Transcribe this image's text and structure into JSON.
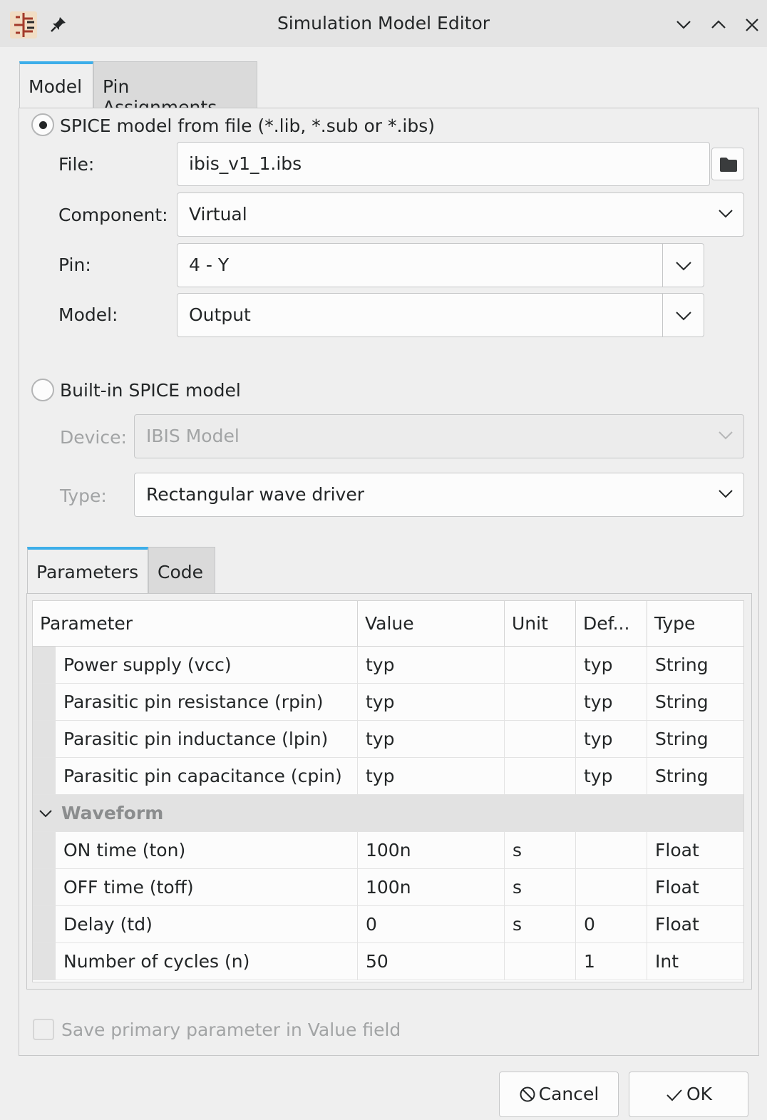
{
  "window": {
    "title": "Simulation Model Editor"
  },
  "top_tabs": [
    {
      "label": "Model",
      "active": true
    },
    {
      "label": "Pin Assignments",
      "active": false
    }
  ],
  "spice_file": {
    "radio_label": "SPICE model from file (*.lib, *.sub or *.ibs)",
    "selected": true,
    "file_label": "File:",
    "file_value": "ibis_v1_1.ibs",
    "component_label": "Component:",
    "component_value": "Virtual",
    "pin_label": "Pin:",
    "pin_value": "4 - Y",
    "model_label": "Model:",
    "model_value": "Output"
  },
  "builtin": {
    "radio_label": "Built-in SPICE model",
    "selected": false,
    "device_label": "Device:",
    "device_value": "IBIS Model",
    "type_label": "Type:",
    "type_value": "Rectangular wave driver"
  },
  "bottom_tabs": [
    {
      "label": "Parameters",
      "active": true
    },
    {
      "label": "Code",
      "active": false
    }
  ],
  "params_table": {
    "headers": [
      "Parameter",
      "Value",
      "Unit",
      "Def...",
      "Type"
    ],
    "rows_top": [
      {
        "parameter": "Power supply (vcc)",
        "value": "typ",
        "unit": "",
        "default": "typ",
        "type": "String"
      },
      {
        "parameter": "Parasitic pin resistance (rpin)",
        "value": "typ",
        "unit": "",
        "default": "typ",
        "type": "String"
      },
      {
        "parameter": "Parasitic pin inductance (lpin)",
        "value": "typ",
        "unit": "",
        "default": "typ",
        "type": "String"
      },
      {
        "parameter": "Parasitic pin capacitance (cpin)",
        "value": "typ",
        "unit": "",
        "default": "typ",
        "type": "String"
      }
    ],
    "group": "Waveform",
    "rows_group": [
      {
        "parameter": "ON time (ton)",
        "value": "100n",
        "unit": "s",
        "default": "",
        "type": "Float"
      },
      {
        "parameter": "OFF time (toff)",
        "value": "100n",
        "unit": "s",
        "default": "",
        "type": "Float"
      },
      {
        "parameter": "Delay (td)",
        "value": "0",
        "unit": "s",
        "default": "0",
        "type": "Float"
      },
      {
        "parameter": "Number of cycles (n)",
        "value": "50",
        "unit": "",
        "default": "1",
        "type": "Int"
      }
    ]
  },
  "save_primary": {
    "label": "Save primary parameter in Value field",
    "checked": false
  },
  "buttons": {
    "cancel": "Cancel",
    "ok": "OK"
  },
  "icons": {
    "app": "schematic-symbol-icon",
    "pin": "pin-icon",
    "minimize": "chevron-down-icon",
    "maximize": "chevron-up-icon",
    "close": "close-icon",
    "browse": "folder-icon"
  }
}
